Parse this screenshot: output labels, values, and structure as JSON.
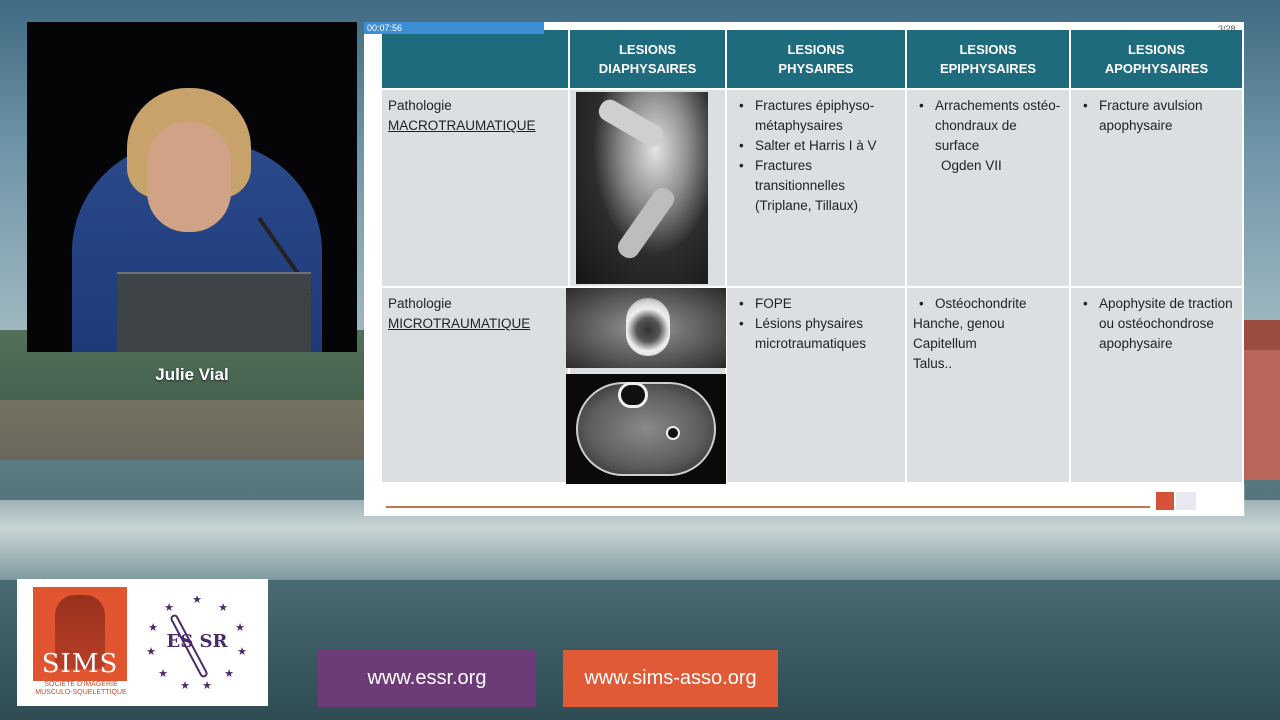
{
  "speaker": {
    "name": "Julie Vial"
  },
  "slide": {
    "timer": "00:07:56",
    "page_number": "3/28",
    "headers": [
      "",
      "LESIONS\nDIAPHYSAIRES",
      "LESIONS\nPHYSAIRES",
      "LESIONS\nEPIPHYSAIRES",
      "LESIONS\nAPOPHYSAIRES"
    ],
    "rows": [
      {
        "pathology_label": "Pathologie",
        "pathology_type": "MACROTRAUMATIQUE",
        "image": "xray-elbow",
        "physaires": [
          "Fractures épiphyso-métaphysaires",
          "Salter et Harris I à V",
          "Fractures transitionnelles (Triplane, Tillaux)"
        ],
        "epiphysaires": [
          "Arrachements ostéo-chondraux de surface"
        ],
        "epiphysaires_extra": "Ogden VII",
        "apophysaires": [
          "Fracture avulsion apophysaire"
        ]
      },
      {
        "pathology_label": "Pathologie",
        "pathology_type": "MICROTRAUMATIQUE",
        "image": "ct-scans",
        "physaires": [
          "FOPE",
          "Lésions physaires microtraumatiques"
        ],
        "epiphysaires": [
          "Ostéochondrite"
        ],
        "epiphysaires_lines": [
          "Hanche, genou",
          "Capitellum",
          "Talus.."
        ],
        "apophysaires": [
          "Apophysite de traction ou ostéochondrose apophysaire"
        ]
      }
    ]
  },
  "logos": {
    "sims": "SIMS",
    "sims_sub": "SOCIÉTÉ D'IMAGERIE MUSCULO-SQUELETTIQUE",
    "essr": "ES SR"
  },
  "links": {
    "essr": "www.essr.org",
    "sims": "www.sims-asso.org"
  },
  "colors": {
    "header_teal": "#1f6b7e",
    "cell_gray": "#dcdfe2",
    "essr_purple": "#6e3b79",
    "sims_orange": "#e05a35",
    "timer_blue": "#3e8ed6"
  }
}
